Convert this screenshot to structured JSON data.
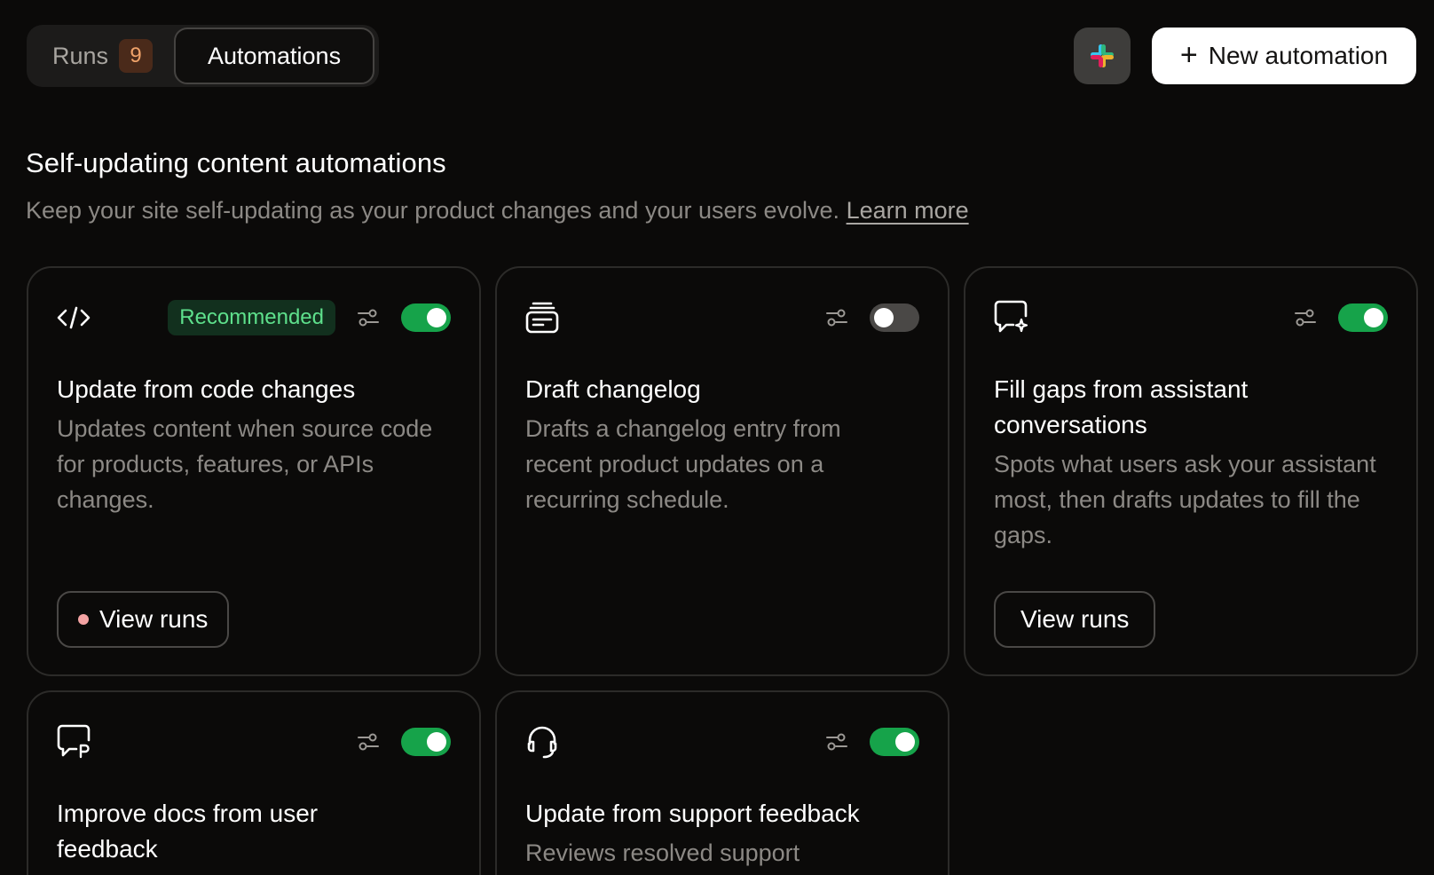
{
  "tabs": {
    "runs_label": "Runs",
    "runs_count": "9",
    "automations_label": "Automations"
  },
  "actions": {
    "slack_icon": "slack-icon",
    "new_automation_label": "New automation"
  },
  "section": {
    "title": "Self-updating content automations",
    "subtitle": "Keep your site self-updating as your product changes and your users evolve.",
    "learn_more": "Learn more"
  },
  "colors": {
    "toggle_on": "#16a34a",
    "toggle_off": "#4a4846",
    "badge_green": "#5ee08c",
    "runs_badge": "#f0a36a"
  },
  "cards": [
    {
      "icon": "code-icon",
      "badge": "Recommended",
      "enabled": true,
      "title": "Update from code changes",
      "description": "Updates content when source code for products, features, or APIs changes.",
      "button": "View runs"
    },
    {
      "icon": "changelog-icon",
      "enabled": false,
      "title": "Draft changelog",
      "description": "Drafts a changelog entry from recent product updates on a recurring schedule."
    },
    {
      "icon": "chat-sparkle-icon",
      "enabled": true,
      "title": "Fill gaps from assistant conversations",
      "description": "Spots what users ask your assistant most, then drafts updates to fill the gaps.",
      "button": "View runs"
    },
    {
      "icon": "feedback-icon",
      "enabled": true,
      "title": "Improve docs from user feedback",
      "description": ""
    },
    {
      "icon": "headset-icon",
      "enabled": true,
      "title": "Update from support feedback",
      "description": "Reviews resolved support"
    }
  ]
}
